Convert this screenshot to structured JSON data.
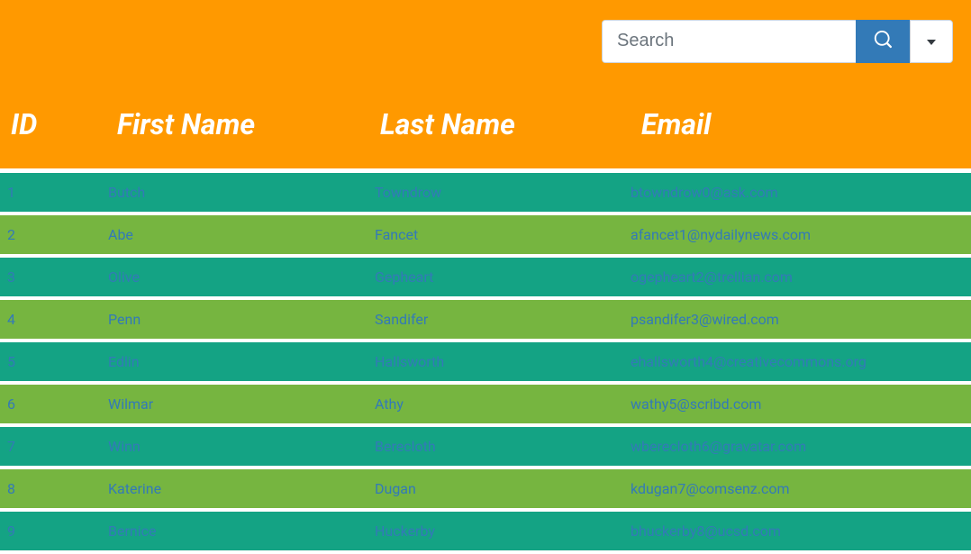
{
  "search": {
    "placeholder": "Search",
    "value": ""
  },
  "columns": [
    "ID",
    "First Name",
    "Last Name",
    "Email"
  ],
  "rows": [
    {
      "id": "1",
      "first": "Butch",
      "last": "Towndrow",
      "email": "btowndrow0@ask.com"
    },
    {
      "id": "2",
      "first": "Abe",
      "last": "Fancet",
      "email": "afancet1@nydailynews.com"
    },
    {
      "id": "3",
      "first": "Olive",
      "last": "Gepheart",
      "email": "ogepheart2@trellian.com"
    },
    {
      "id": "4",
      "first": "Penn",
      "last": "Sandifer",
      "email": "psandifer3@wired.com"
    },
    {
      "id": "5",
      "first": "Edlin",
      "last": "Hallsworth",
      "email": "ehallsworth4@creativecommons.org"
    },
    {
      "id": "6",
      "first": "Wilmar",
      "last": "Athy",
      "email": "wathy5@scribd.com"
    },
    {
      "id": "7",
      "first": "Winn",
      "last": "Berecloth",
      "email": "wberecloth6@gravatar.com"
    },
    {
      "id": "8",
      "first": "Katerine",
      "last": "Dugan",
      "email": "kdugan7@comsenz.com"
    },
    {
      "id": "9",
      "first": "Bernice",
      "last": "Huckerby",
      "email": "bhuckerby8@ucsd.com"
    }
  ]
}
